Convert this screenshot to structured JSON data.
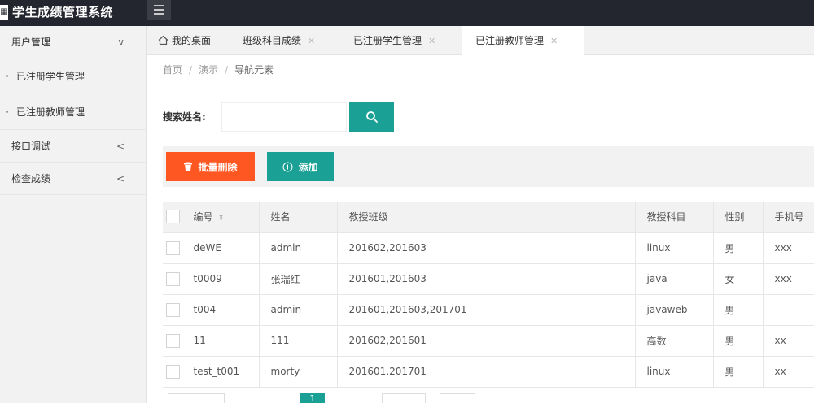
{
  "app": {
    "title": "学生成绩管理系统",
    "logo_glyph": "▦"
  },
  "sidebar": {
    "groups": [
      {
        "label": "用户管理",
        "chevron": "∨",
        "children": [
          "已注册学生管理",
          "已注册教师管理"
        ]
      },
      {
        "label": "接口调试",
        "chevron": "<"
      },
      {
        "label": "检查成绩",
        "chevron": "<"
      }
    ]
  },
  "tabs": [
    {
      "label": "我的桌面",
      "icon": "home-icon",
      "closable": false
    },
    {
      "label": "班级科目成绩",
      "closable": true
    },
    {
      "label": "已注册学生管理",
      "closable": true
    },
    {
      "label": "已注册教师管理",
      "closable": true,
      "active": true
    }
  ],
  "close_glyph": "✕",
  "breadcrumb": {
    "items": [
      "首页",
      "演示",
      "导航元素"
    ],
    "separator": "/"
  },
  "search": {
    "label": "搜索姓名:",
    "value": "",
    "placeholder": "",
    "button_icon": "search-icon"
  },
  "toolbar": {
    "batch_delete_label": "批量删除",
    "add_label": "添加"
  },
  "colors": {
    "primary": "#1aa094",
    "danger": "#ff5722",
    "topbar": "#23262e"
  },
  "table": {
    "columns": [
      "编号",
      "姓名",
      "教授班级",
      "教授科目",
      "性别",
      "手机号"
    ],
    "rows": [
      [
        "deWE",
        "admin",
        "201602,201603",
        "linux",
        "男",
        "xxx"
      ],
      [
        "t0009",
        "张瑞红",
        "201601,201603",
        "java",
        "女",
        "xxx"
      ],
      [
        "t004",
        "admin",
        "201601,201603,201701",
        "javaweb",
        "男",
        ""
      ],
      [
        "11",
        "111",
        "201602,201601",
        "高数",
        "男",
        "xx"
      ],
      [
        "test_t001",
        "morty",
        "201601,201701",
        "linux",
        "男",
        "xx"
      ]
    ]
  },
  "pager": {
    "current_page": "1"
  }
}
